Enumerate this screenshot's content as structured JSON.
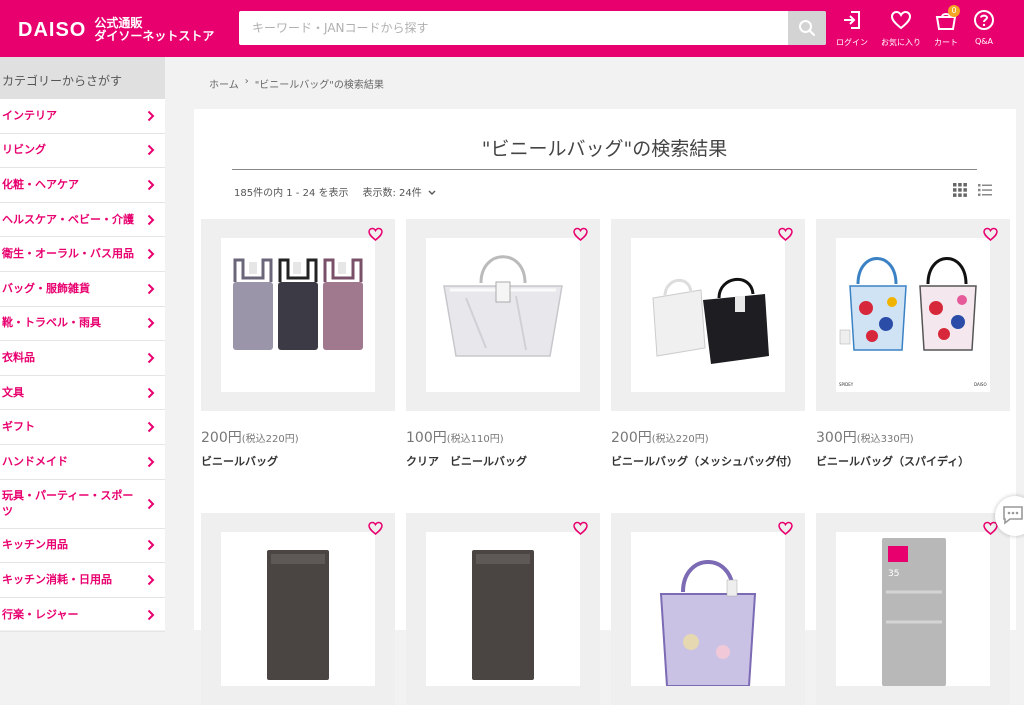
{
  "header": {
    "logo": "DAISO",
    "tagline_1": "公式通販",
    "tagline_2": "ダイソーネットストア",
    "search_placeholder": "キーワード・JANコードから探す",
    "actions": {
      "login": "ログイン",
      "favorites": "お気に入り",
      "cart": "カート",
      "cart_count": "0",
      "qa": "Q&A"
    },
    "accent_color": "#e8006f"
  },
  "sidebar": {
    "heading": "カテゴリーからさがす",
    "items": [
      "インテリア",
      "リビング",
      "化粧・ヘアケア",
      "ヘルスケア・ベビー・介護",
      "衛生・オーラル・バス用品",
      "バッグ・服飾雑貨",
      "靴・トラベル・雨具",
      "衣料品",
      "文具",
      "ギフト",
      "ハンドメイド",
      "玩具・パーティー・スポーツ",
      "キッチン用品",
      "キッチン消耗・日用品",
      "行楽・レジャー"
    ]
  },
  "breadcrumb": {
    "home": "ホーム",
    "separator": "›",
    "current": "\"ビニールバッグ\"の検索結果"
  },
  "results": {
    "title": "\"ビニールバッグ\"の検索結果",
    "count_text": "185件の内 1 - 24 を表示",
    "per_page": "表示数: 24件"
  },
  "products": [
    {
      "price": "200円",
      "tax": "(税込220円)",
      "name": "ビニールバッグ",
      "image": "three-mesh-bags"
    },
    {
      "price": "100円",
      "tax": "(税込110円)",
      "name": "クリア　ビニールバッグ",
      "image": "clear-tote"
    },
    {
      "price": "200円",
      "tax": "(税込220円)",
      "name": "ビニールバッグ（メッシュバッグ付）",
      "image": "white-black-bags"
    },
    {
      "price": "300円",
      "tax": "(税込330円)",
      "name": "ビニールバッグ（スパイディ）",
      "image": "spidey-bags"
    },
    {
      "price": "",
      "tax": "",
      "name": "",
      "image": "dark-pouch"
    },
    {
      "price": "",
      "tax": "",
      "name": "",
      "image": "dark-pouch"
    },
    {
      "price": "",
      "tax": "",
      "name": "",
      "image": "purple-tote"
    },
    {
      "price": "",
      "tax": "",
      "name": "",
      "image": "silver-pack"
    }
  ],
  "product_image_texts": {
    "spidey_left": "SPIDEY",
    "spidey_right": "DAISO",
    "silver_pack": "35"
  }
}
